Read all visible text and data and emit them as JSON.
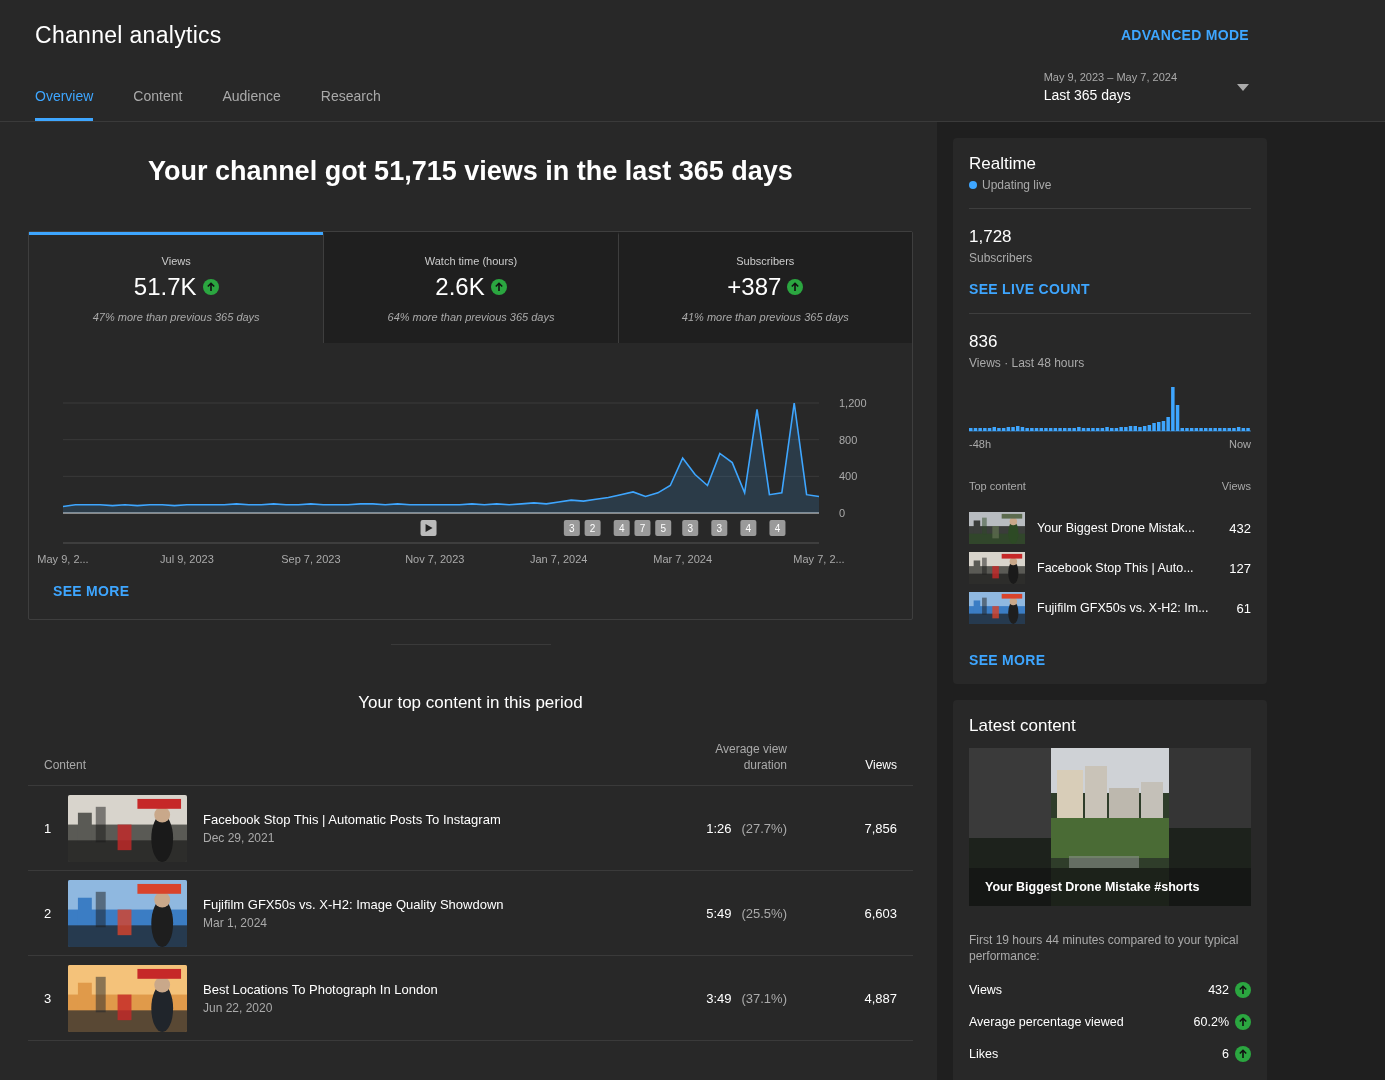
{
  "header": {
    "title": "Channel analytics",
    "advanced_mode": "ADVANCED MODE",
    "tabs": [
      {
        "label": "Overview",
        "selected": true
      },
      {
        "label": "Content",
        "selected": false
      },
      {
        "label": "Audience",
        "selected": false
      },
      {
        "label": "Research",
        "selected": false
      }
    ],
    "date_range": {
      "dates": "May 9, 2023 – May 7, 2024",
      "label": "Last 365 days"
    }
  },
  "summary": {
    "headline": "Your channel got 51,715 views in the last 365 days",
    "metrics": [
      {
        "label": "Views",
        "value": "51.7K",
        "note": "47% more than previous 365 days",
        "selected": true
      },
      {
        "label": "Watch time (hours)",
        "value": "2.6K",
        "note": "64% more than previous 365 days",
        "selected": false
      },
      {
        "label": "Subscribers",
        "value": "+387",
        "note": "41% more than previous 365 days",
        "selected": false
      }
    ],
    "chart_data": {
      "type": "area",
      "categories": [
        "May 9, 2...",
        null,
        null,
        null,
        null,
        null,
        null,
        null,
        null,
        null,
        "Jul 9, 2023",
        null,
        null,
        null,
        null,
        null,
        null,
        null,
        null,
        null,
        "Sep 7, 2023",
        null,
        null,
        null,
        null,
        null,
        null,
        null,
        null,
        null,
        "Nov 7, 2023",
        null,
        null,
        null,
        null,
        null,
        null,
        null,
        null,
        null,
        "Jan 7, 2024",
        null,
        null,
        null,
        null,
        null,
        null,
        null,
        null,
        null,
        "Mar 7, 2024",
        null,
        null,
        null,
        null,
        null,
        null,
        null,
        null,
        null,
        null,
        "May 7, 2..."
      ],
      "series": [
        {
          "color": "#3ea6ff",
          "values": [
            70,
            90,
            90,
            90,
            80,
            90,
            80,
            90,
            90,
            80,
            90,
            90,
            90,
            90,
            100,
            90,
            90,
            100,
            90,
            90,
            100,
            90,
            90,
            90,
            100,
            100,
            90,
            100,
            90,
            90,
            90,
            90,
            90,
            100,
            90,
            100,
            90,
            100,
            110,
            100,
            120,
            140,
            130,
            150,
            170,
            200,
            230,
            180,
            220,
            300,
            600,
            420,
            300,
            650,
            550,
            220,
            1130,
            200,
            220,
            1200,
            200,
            180
          ]
        }
      ],
      "ylim": [
        0,
        1200
      ],
      "yticks": [
        {
          "value": 0,
          "label": "0"
        },
        {
          "value": 400,
          "label": "400"
        },
        {
          "value": 800,
          "label": "800"
        },
        {
          "value": 1200,
          "label": "1,200"
        }
      ]
    },
    "markers": [
      {
        "kind": "video"
      },
      {
        "kind": "count",
        "label": "3"
      },
      {
        "kind": "count",
        "label": "2"
      },
      {
        "kind": "count",
        "label": "4"
      },
      {
        "kind": "count",
        "label": "7"
      },
      {
        "kind": "count",
        "label": "5"
      },
      {
        "kind": "count",
        "label": "3"
      },
      {
        "kind": "count",
        "label": "3"
      },
      {
        "kind": "count",
        "label": "4"
      },
      {
        "kind": "count",
        "label": "4"
      }
    ],
    "see_more": "SEE MORE"
  },
  "top_content": {
    "title": "Your top content in this period",
    "columns": [
      "Content",
      "Average view duration",
      "Views"
    ],
    "rows": [
      {
        "rank": "1",
        "title": "Facebook Stop This | Automatic Posts To Instagram",
        "date": "Dec 29, 2021",
        "duration": "1:26",
        "percent": "(27.7%)",
        "views": "7,856"
      },
      {
        "rank": "2",
        "title": "Fujifilm GFX50s vs. X-H2: Image Quality Showdown",
        "date": "Mar 1, 2024",
        "duration": "5:49",
        "percent": "(25.5%)",
        "views": "6,603"
      },
      {
        "rank": "3",
        "title": "Best Locations To Photograph In London",
        "date": "Jun 22, 2020",
        "duration": "3:49",
        "percent": "(37.1%)",
        "views": "4,887"
      }
    ]
  },
  "realtime": {
    "title": "Realtime",
    "status": "Updating live",
    "subscribers": "1,728",
    "subscribers_label": "Subscribers",
    "live_count": "SEE LIVE COUNT",
    "views": "836",
    "views_label": "Views · Last 48 hours",
    "axis_start": "-48h",
    "axis_end": "Now",
    "top_header": "Top content",
    "views_header": "Views",
    "items": [
      {
        "title": "Your Biggest Drone Mistak...",
        "views": "432"
      },
      {
        "title": "Facebook Stop This | Auto...",
        "views": "127"
      },
      {
        "title": "Fujifilm GFX50s vs. X-H2: Im...",
        "views": "61"
      }
    ],
    "see_more": "SEE MORE"
  },
  "latest": {
    "title": "Latest content",
    "video_title": "Your Biggest Drone Mistake #shorts",
    "note": "First 19 hours 44 minutes compared to your typical performance:",
    "stats": [
      {
        "label": "Views",
        "value": "432"
      },
      {
        "label": "Average percentage viewed",
        "value": "60.2%"
      },
      {
        "label": "Likes",
        "value": "6"
      }
    ]
  }
}
